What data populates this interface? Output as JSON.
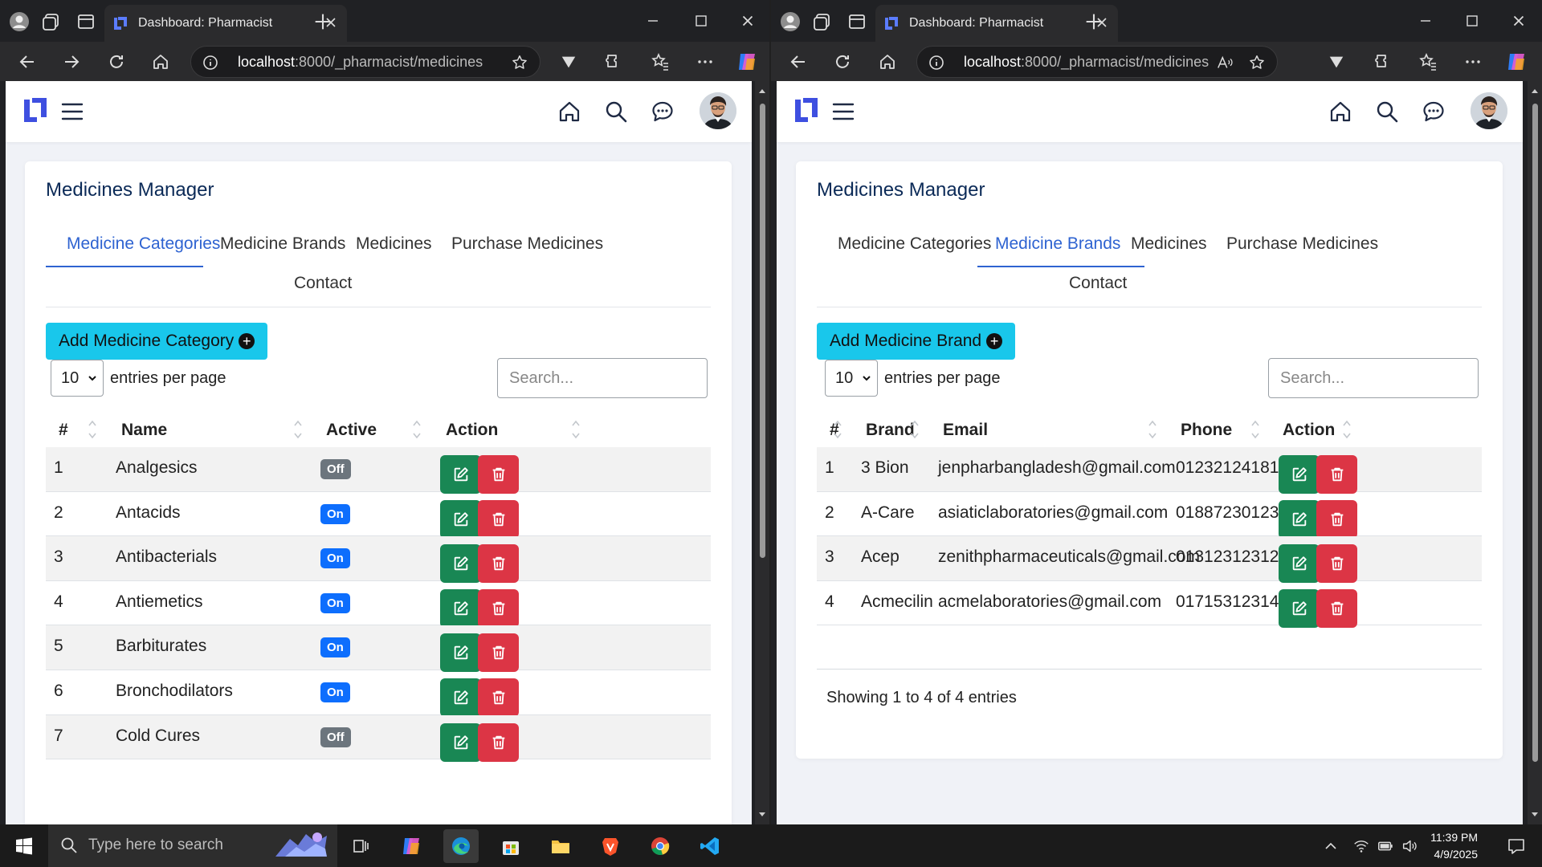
{
  "browser": {
    "tab_title": "Dashboard: Pharmacist",
    "url_host": "localhost",
    "url_rest": ":8000/_pharmacist/medicines"
  },
  "app": {
    "card_title": "Medicines Manager",
    "tabs": [
      "Medicine Categories",
      "Medicine Brands",
      "Medicines",
      "Purchase Medicines",
      "Contact"
    ],
    "entries_per_page_value": "10",
    "entries_per_page_label": "entries per page",
    "search_placeholder": "Search..."
  },
  "left": {
    "active_tab": "Medicine Categories",
    "add_button": "Add Medicine Category",
    "columns": [
      "#",
      "Name",
      "Active",
      "Action"
    ],
    "rows": [
      {
        "n": "1",
        "name": "Analgesics",
        "active": "Off"
      },
      {
        "n": "2",
        "name": "Antacids",
        "active": "On"
      },
      {
        "n": "3",
        "name": "Antibacterials",
        "active": "On"
      },
      {
        "n": "4",
        "name": "Antiemetics",
        "active": "On"
      },
      {
        "n": "5",
        "name": "Barbiturates",
        "active": "On"
      },
      {
        "n": "6",
        "name": "Bronchodilators",
        "active": "On"
      },
      {
        "n": "7",
        "name": "Cold Cures",
        "active": "Off"
      }
    ]
  },
  "right": {
    "active_tab": "Medicine Brands",
    "add_button": "Add Medicine Brand",
    "columns": [
      "#",
      "Brand",
      "Email",
      "Phone",
      "Action"
    ],
    "rows": [
      {
        "n": "1",
        "brand": "3 Bion",
        "email": "jenpharbangladesh@gmail.com",
        "phone": "01232124181"
      },
      {
        "n": "2",
        "brand": "A-Care",
        "email": "asiaticlaboratories@gmail.com",
        "phone": "01887230123"
      },
      {
        "n": "3",
        "brand": "Acep",
        "email": "zenithpharmaceuticals@gmail.com",
        "phone": "01312312312"
      },
      {
        "n": "4",
        "brand": "Acmecilin",
        "email": "acmelaboratories@gmail.com",
        "phone": "01715312314"
      }
    ],
    "footer": "Showing 1 to 4 of 4 entries"
  },
  "taskbar": {
    "search_placeholder": "Type here to search",
    "time": "11:39 PM",
    "date": "4/9/2025"
  },
  "colors": {
    "accent": "#2e63d1",
    "add_button": "#19c7eb",
    "edit": "#198754",
    "delete": "#dc3545",
    "badge_on": "#0d6efd",
    "badge_off": "#6c757d"
  }
}
